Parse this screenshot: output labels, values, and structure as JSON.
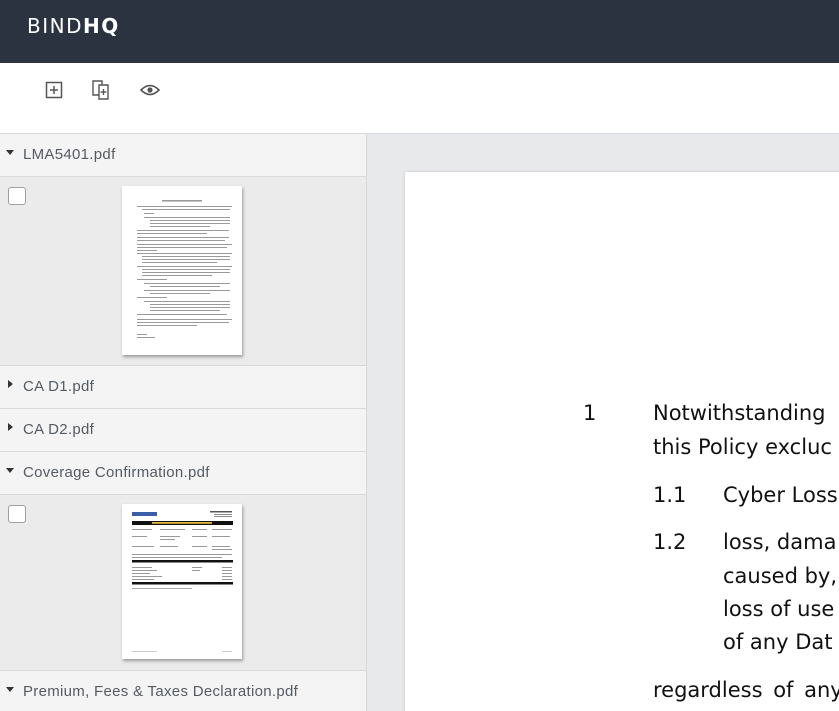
{
  "app": {
    "logo_light": "BIND",
    "logo_bold": "HQ"
  },
  "toolbar": {
    "buttons": [
      {
        "icon": "add-page-icon"
      },
      {
        "icon": "copy-page-icon"
      },
      {
        "icon": "eye-icon"
      }
    ]
  },
  "sidebar": {
    "groups": [
      {
        "name": "LMA5401.pdf",
        "expanded": true
      },
      {
        "name": "CA D1.pdf",
        "expanded": false
      },
      {
        "name": "CA D2.pdf",
        "expanded": false
      },
      {
        "name": "Coverage Confirmation.pdf",
        "expanded": true
      },
      {
        "name": "Premium, Fees & Taxes Declaration.pdf",
        "expanded": true
      }
    ]
  },
  "document": {
    "clause_number": "1",
    "clause_line1": "Notwithstanding",
    "clause_line2": "this Policy excluc",
    "sub1_number": "1.1",
    "sub1_text": "Cyber Loss",
    "sub2_number": "1.2",
    "sub2_line1": "loss, dama",
    "sub2_line2": "caused by,",
    "sub2_line3": "loss of use",
    "sub2_line4": "of any Dat",
    "trailing_line": "regardless of any"
  }
}
